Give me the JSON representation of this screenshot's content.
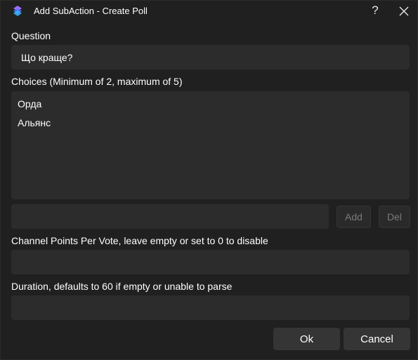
{
  "window": {
    "title": "Add SubAction - Create Poll",
    "help_label": "?"
  },
  "question": {
    "label": "Question",
    "value": "Що краще?"
  },
  "choices": {
    "label": "Choices (Minimum of 2, maximum of 5)",
    "items": [
      "Орда",
      "Альянс"
    ],
    "new_choice_value": "",
    "add_label": "Add",
    "del_label": "Del"
  },
  "channel_points": {
    "label": "Channel Points Per Vote, leave empty or set to 0 to disable",
    "value": ""
  },
  "duration": {
    "label": "Duration, defaults to 60 if empty or unable to parse",
    "value": ""
  },
  "footer": {
    "ok_label": "Ok",
    "cancel_label": "Cancel"
  },
  "colors": {
    "background": "#202020",
    "field": "#2c2c2c",
    "button": "#353535",
    "disabled_text": "#7a7a7a",
    "icon_accent": "#7b5cff"
  }
}
